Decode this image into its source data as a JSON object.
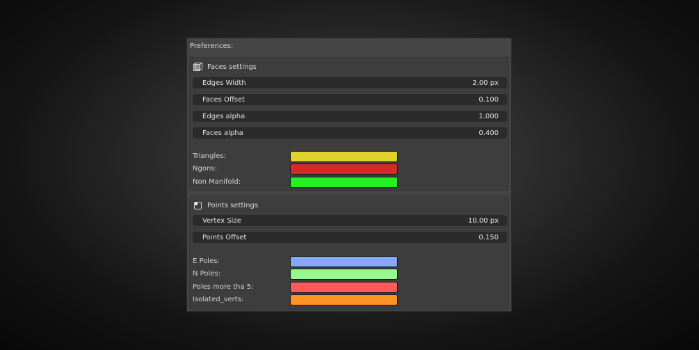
{
  "window": {
    "title": "Preferences:"
  },
  "faces": {
    "header": "Faces settings",
    "fields": [
      {
        "label": "Edges Width",
        "value": "2.00 px"
      },
      {
        "label": "Faces Offset",
        "value": "0.100"
      },
      {
        "label": "Edges alpha",
        "value": "1.000"
      },
      {
        "label": "Faces alpha",
        "value": "0.400"
      }
    ],
    "colors": [
      {
        "label": "Triangles:",
        "color": "#e0d22c"
      },
      {
        "label": "Ngons:",
        "color": "#d42a2a"
      },
      {
        "label": "Non Manifold:",
        "color": "#22f222"
      }
    ]
  },
  "points": {
    "header": "Points settings",
    "fields": [
      {
        "label": "Vertex Size",
        "value": "10.00 px"
      },
      {
        "label": "Points Offset",
        "value": "0.150"
      }
    ],
    "colors": [
      {
        "label": "E Poles:",
        "color": "#88a8ff"
      },
      {
        "label": "N Poles:",
        "color": "#98f890"
      },
      {
        "label": "Poles more tha 5:",
        "color": "#ff5a5a"
      },
      {
        "label": "Isolated_verts:",
        "color": "#ff9424"
      }
    ]
  }
}
